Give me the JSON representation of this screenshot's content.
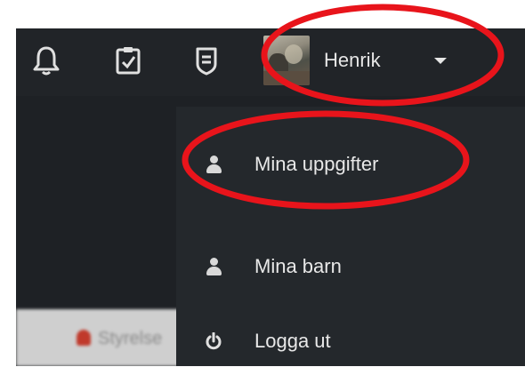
{
  "topbar": {
    "icons": [
      "bell-icon",
      "task-check-icon",
      "badge-icon"
    ],
    "user_name": "Henrik",
    "caret_icon": "caret-down-icon"
  },
  "dropdown": {
    "items": [
      {
        "label": "Mina uppgifter",
        "icon": "person-icon"
      },
      {
        "label": "Mina barn",
        "icon": "person-icon"
      },
      {
        "label": "Logga ut",
        "icon": "power-icon"
      }
    ]
  },
  "background_tab": {
    "label": "Styrelse"
  },
  "colors": {
    "topbar": "#212428",
    "dropdown": "#24282c",
    "text": "#e8e8e8",
    "annotation": "#e8141b"
  }
}
